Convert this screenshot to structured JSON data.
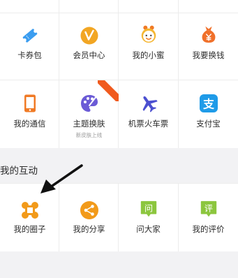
{
  "top_grid": {
    "row1": [
      {
        "label": "卡券包",
        "icon": "ticket-icon",
        "color": "#3b9df0"
      },
      {
        "label": "会员中心",
        "icon": "vip-icon",
        "color": "#f2a623"
      },
      {
        "label": "我的小蜜",
        "icon": "assistant-face-icon",
        "color": "#f5b632"
      },
      {
        "label": "我要换钱",
        "icon": "money-bag-icon",
        "color": "#f0702a"
      }
    ],
    "row2": [
      {
        "label": "我的通信",
        "icon": "phone-icon",
        "color": "#f07a25"
      },
      {
        "label": "主题换肤",
        "icon": "palette-icon",
        "color": "#6b5bd6",
        "sub": "新皮肤上线",
        "ribbon": ""
      },
      {
        "label": "机票火车票",
        "icon": "airplane-icon",
        "color": "#4b4fd0"
      },
      {
        "label": "支付宝",
        "icon": "alipay-icon",
        "color": "#1f9be8",
        "glyph": "支"
      }
    ]
  },
  "interaction": {
    "title": "我的互动",
    "items": [
      {
        "label": "我的圈子",
        "icon": "circle-group-icon",
        "color": "#f29a1a"
      },
      {
        "label": "我的分享",
        "icon": "share-icon",
        "color": "#f29a1a"
      },
      {
        "label": "问大家",
        "icon": "ask-icon",
        "color": "#8cc63e",
        "glyph": "问"
      },
      {
        "label": "我的评价",
        "icon": "review-icon",
        "color": "#8cc63e",
        "glyph": "评"
      }
    ]
  }
}
